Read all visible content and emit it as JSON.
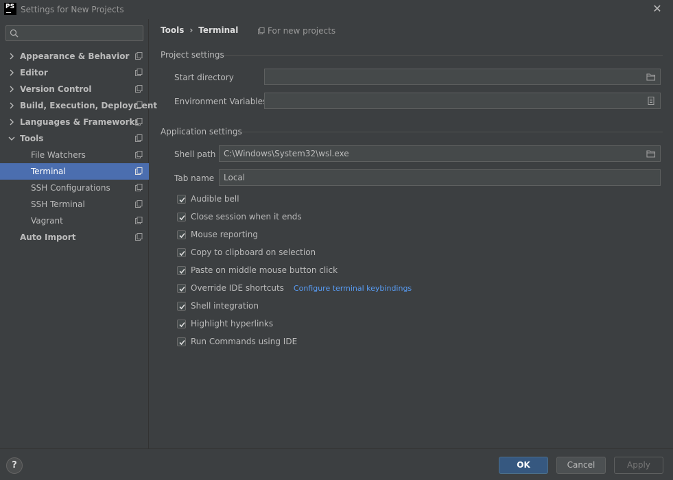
{
  "window": {
    "title": "Settings for New Projects",
    "logo": "PS"
  },
  "search": {
    "placeholder": ""
  },
  "sidebar": {
    "items": [
      {
        "label": "Appearance & Behavior",
        "level": "top",
        "expanded": false
      },
      {
        "label": "Editor",
        "level": "top",
        "expanded": false
      },
      {
        "label": "Version Control",
        "level": "top",
        "expanded": false
      },
      {
        "label": "Build, Execution, Deployment",
        "level": "top",
        "expanded": false
      },
      {
        "label": "Languages & Frameworks",
        "level": "top",
        "expanded": false
      },
      {
        "label": "Tools",
        "level": "top",
        "expanded": true
      },
      {
        "label": "File Watchers",
        "level": "child"
      },
      {
        "label": "Terminal",
        "level": "child",
        "selected": true
      },
      {
        "label": "SSH Configurations",
        "level": "child"
      },
      {
        "label": "SSH Terminal",
        "level": "child"
      },
      {
        "label": "Vagrant",
        "level": "child"
      },
      {
        "label": "Auto Import",
        "level": "top",
        "no_chevron": true
      }
    ]
  },
  "header": {
    "breadcrumb_parent": "Tools",
    "breadcrumb_sep": "›",
    "breadcrumb_current": "Terminal",
    "scope_note": "For new projects"
  },
  "project_settings": {
    "title": "Project settings",
    "start_directory_label": "Start directory",
    "start_directory_value": "",
    "env_vars_label": "Environment Variables",
    "env_vars_value": ""
  },
  "application_settings": {
    "title": "Application settings",
    "shell_path_label": "Shell path",
    "shell_path_value": "C:\\Windows\\System32\\wsl.exe",
    "tab_name_label": "Tab name",
    "tab_name_value": "Local"
  },
  "checkboxes": [
    {
      "label": "Audible bell",
      "checked": true
    },
    {
      "label": "Close session when it ends",
      "checked": true
    },
    {
      "label": "Mouse reporting",
      "checked": true
    },
    {
      "label": "Copy to clipboard on selection",
      "checked": true
    },
    {
      "label": "Paste on middle mouse button click",
      "checked": true
    },
    {
      "label": "Override IDE shortcuts",
      "checked": true
    },
    {
      "label": "Shell integration",
      "checked": true
    },
    {
      "label": "Highlight hyperlinks",
      "checked": true
    },
    {
      "label": "Run Commands using IDE",
      "checked": true
    }
  ],
  "keybindings_link": "Configure terminal keybindings",
  "footer": {
    "help": "?",
    "ok": "OK",
    "cancel": "Cancel",
    "apply": "Apply"
  },
  "colors": {
    "background": "#3c3f41",
    "selection": "#4b6eaf",
    "link": "#589df6",
    "primary_button": "#365880"
  }
}
